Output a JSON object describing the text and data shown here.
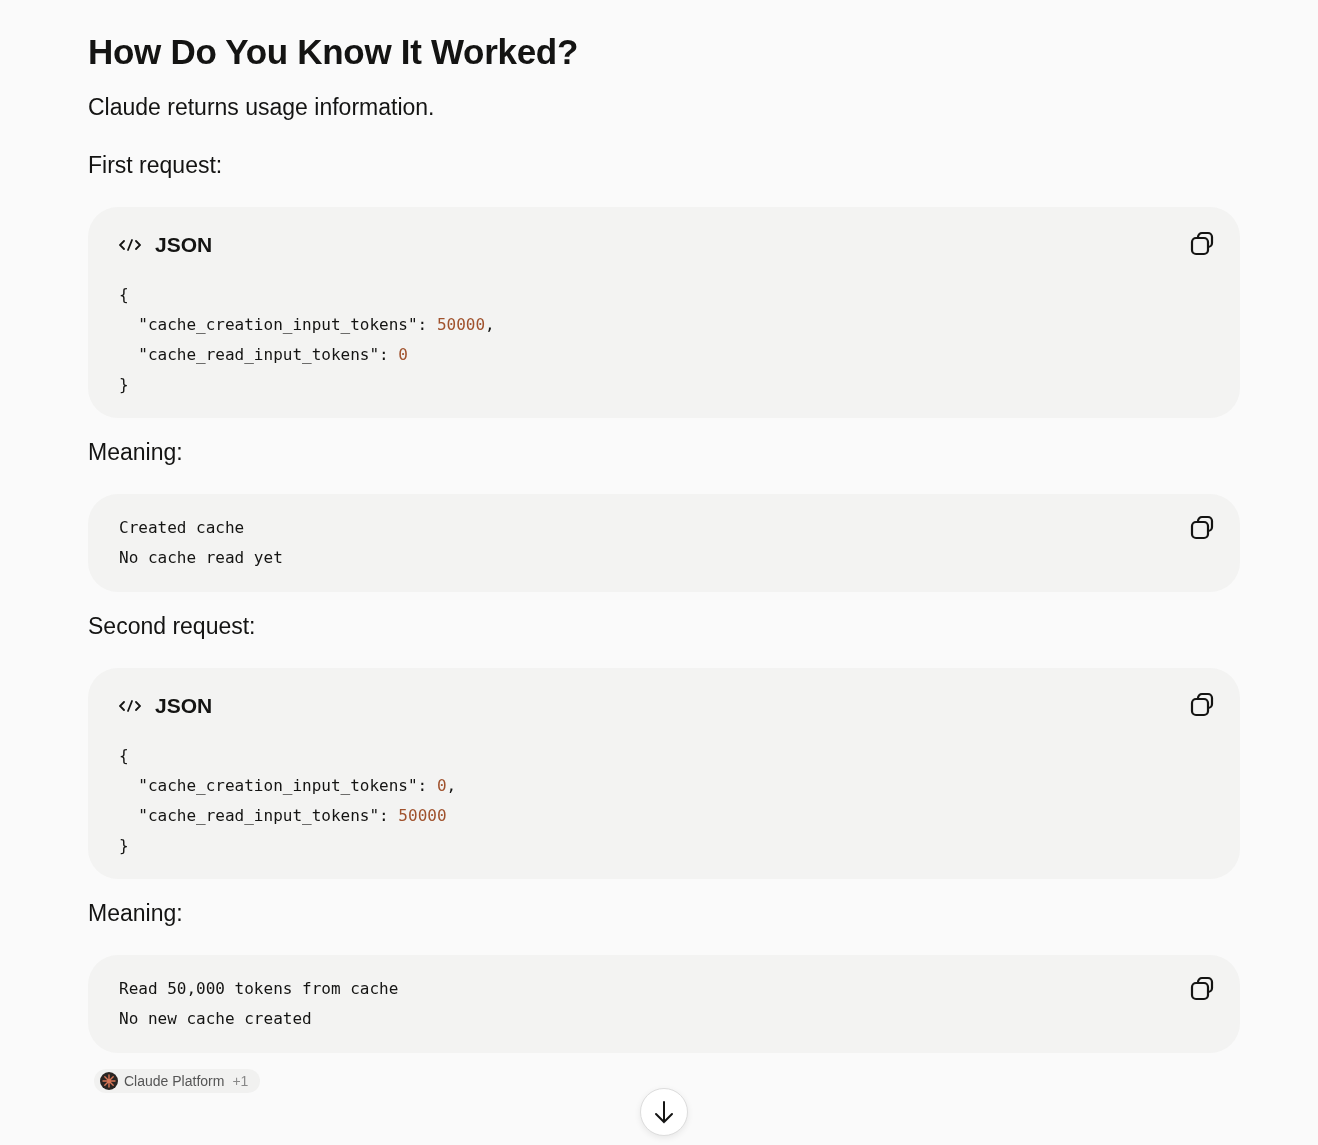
{
  "title": "How Do You Know It Worked?",
  "blocks": [
    {
      "kind": "paragraph",
      "text": "Claude returns usage information."
    },
    {
      "kind": "paragraph",
      "text": "First request:"
    },
    {
      "kind": "code",
      "language": "JSON",
      "lines": [
        [
          {
            "kind": "plain",
            "text": "{"
          }
        ],
        [
          {
            "kind": "plain",
            "text": "  \"cache_creation_input_tokens\": "
          },
          {
            "kind": "number",
            "text": "50000"
          },
          {
            "kind": "plain",
            "text": ","
          }
        ],
        [
          {
            "kind": "plain",
            "text": "  \"cache_read_input_tokens\": "
          },
          {
            "kind": "number",
            "text": "0"
          }
        ],
        [
          {
            "kind": "plain",
            "text": "}"
          }
        ]
      ]
    },
    {
      "kind": "paragraph",
      "text": "Meaning:"
    },
    {
      "kind": "code",
      "lines": [
        [
          {
            "kind": "plain",
            "text": "Created cache"
          }
        ],
        [
          {
            "kind": "plain",
            "text": "No cache read yet"
          }
        ]
      ]
    },
    {
      "kind": "paragraph",
      "text": "Second request:"
    },
    {
      "kind": "code",
      "language": "JSON",
      "lines": [
        [
          {
            "kind": "plain",
            "text": "{"
          }
        ],
        [
          {
            "kind": "plain",
            "text": "  \"cache_creation_input_tokens\": "
          },
          {
            "kind": "number",
            "text": "0"
          },
          {
            "kind": "plain",
            "text": ","
          }
        ],
        [
          {
            "kind": "plain",
            "text": "  \"cache_read_input_tokens\": "
          },
          {
            "kind": "number",
            "text": "50000"
          }
        ],
        [
          {
            "kind": "plain",
            "text": "}"
          }
        ]
      ]
    },
    {
      "kind": "paragraph",
      "text": "Meaning:"
    },
    {
      "kind": "code",
      "lines": [
        [
          {
            "kind": "plain",
            "text": "Read 50,000 tokens from cache"
          }
        ],
        [
          {
            "kind": "plain",
            "text": "No new cache created"
          }
        ]
      ]
    }
  ],
  "source_chip": {
    "label": "Claude Platform",
    "count": "+1"
  }
}
